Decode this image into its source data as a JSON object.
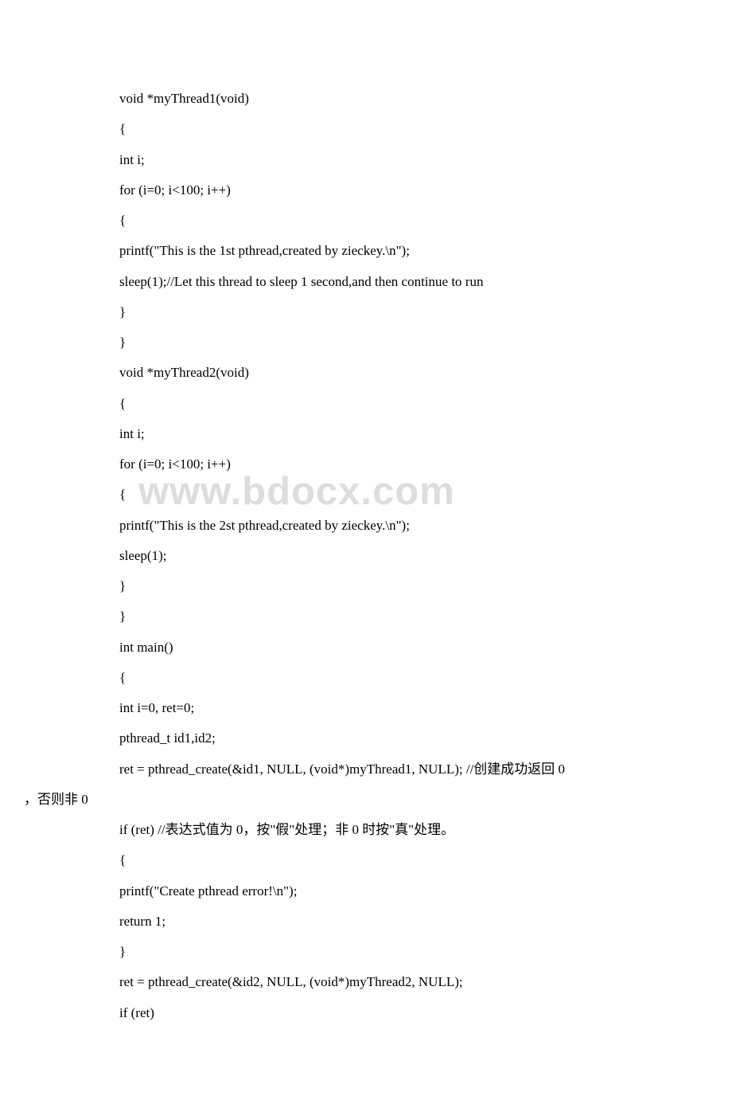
{
  "watermark": "www.bdocx.com",
  "code": {
    "lines": [
      "void *myThread1(void)",
      "{",
      "int i;",
      "for (i=0; i<100; i++)",
      "{",
      "printf(\"This is the 1st pthread,created by zieckey.\\n\");",
      "sleep(1);//Let this thread to sleep 1 second,and then continue to run",
      "}",
      "}",
      "void *myThread2(void)",
      "{",
      "int i;",
      "for (i=0; i<100; i++)",
      "{",
      "printf(\"This is the 2st pthread,created by zieckey.\\n\");",
      "sleep(1);",
      "}",
      "}",
      "int main()",
      "{",
      "int i=0, ret=0;",
      "pthread_t id1,id2;",
      "ret = pthread_create(&id1, NULL, (void*)myThread1, NULL); //创建成功返回 0",
      "，否则非 0",
      "if (ret) //表达式值为 0，按\"假\"处理；非 0 时按\"真\"处理。",
      "{",
      "printf(\"Create pthread error!\\n\");",
      "return 1;",
      "}",
      "ret = pthread_create(&id2, NULL, (void*)myThread2, NULL);",
      "if (ret)"
    ]
  }
}
